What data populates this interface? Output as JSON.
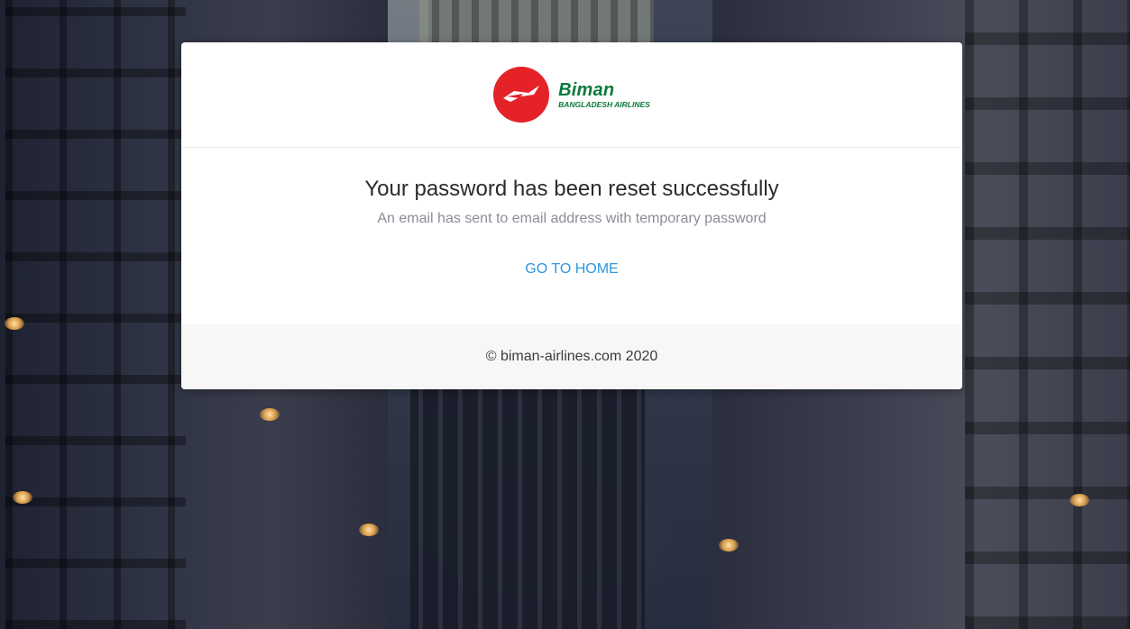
{
  "brand": {
    "name": "Biman",
    "tagline": "BANGLADESH AIRLINES",
    "color": "#0a7a3c",
    "mark_color": "#e52228"
  },
  "message": {
    "title": "Your password has been reset successfully",
    "subtitle": "An email has sent to email address with temporary password"
  },
  "actions": {
    "home_label": "GO TO HOME",
    "link_color": "#2d97de"
  },
  "footer": {
    "copyright": "© biman-airlines.com 2020"
  }
}
